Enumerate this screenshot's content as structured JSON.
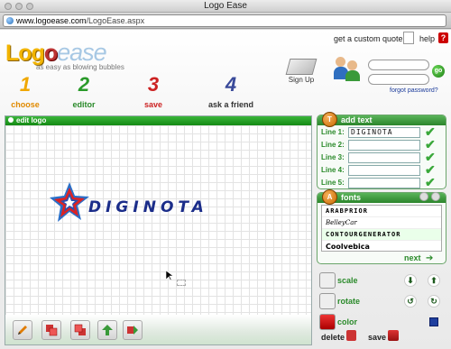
{
  "window": {
    "title": "Logo Ease"
  },
  "browser": {
    "url_domain": "www.logoease.com",
    "url_path": "/LogoEase.aspx"
  },
  "header": {
    "logo_part1": "Log",
    "logo_part2": "o",
    "logo_part3": "e",
    "logo_part4": "ase",
    "tagline": "as easy as blowing bubbles",
    "custom_quote": "get a custom quote",
    "help": "help",
    "help_icon": "?",
    "signup": "Sign Up",
    "go": "go",
    "forgot": "forgot password?"
  },
  "nav": [
    {
      "num": "1",
      "label": "choose"
    },
    {
      "num": "2",
      "label": "editor"
    },
    {
      "num": "3",
      "label": "save"
    },
    {
      "num": "4",
      "label": "ask a friend"
    }
  ],
  "editor": {
    "title": "edit logo",
    "logo_text": "DIGINOTA"
  },
  "add_text": {
    "title": "add text",
    "badge": "T",
    "lines": [
      {
        "label": "Line 1:",
        "value": "DIGINOTA"
      },
      {
        "label": "Line 2:",
        "value": ""
      },
      {
        "label": "Line 3:",
        "value": ""
      },
      {
        "label": "Line 4:",
        "value": ""
      },
      {
        "label": "Line 5:",
        "value": ""
      }
    ]
  },
  "fonts": {
    "title": "fonts",
    "badge": "A",
    "items": [
      "ARABPRIOR",
      "BelleyCar",
      "CONTOURGENERATOR",
      "Coolvebica"
    ],
    "next": "next"
  },
  "controls": {
    "scale": "scale",
    "rotate": "rotate",
    "color": "color",
    "delete": "delete",
    "save": "save"
  },
  "colors": {
    "accent_green": "#2a8a2a",
    "logo_blue": "#1b2d8a",
    "logo_red": "#d22"
  }
}
